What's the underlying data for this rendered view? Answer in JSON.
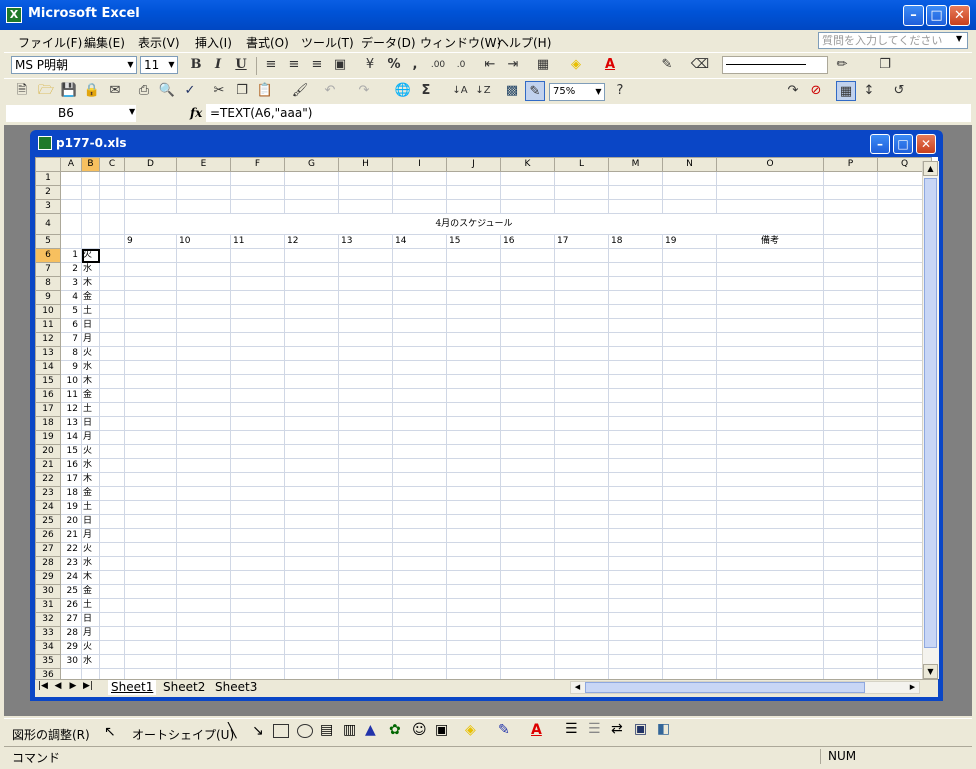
{
  "window": {
    "title": "Microsoft Excel",
    "app_icon": "X"
  },
  "menu": [
    "ファイル(F)",
    "編集(E)",
    "表示(V)",
    "挿入(I)",
    "書式(O)",
    "ツール(T)",
    "データ(D)",
    "ウィンドウ(W)",
    "ヘルプ(H)"
  ],
  "help_placeholder": "質問を入力してください",
  "format_toolbar": {
    "font": "MS P明朝",
    "size": "11",
    "bold": "B",
    "italic": "I",
    "underline": "U",
    "percent": "%",
    "comma": ","
  },
  "standard_toolbar": {
    "zoom": "75%",
    "sum": "Σ"
  },
  "formula_bar": {
    "cell": "B6",
    "fx": "fx",
    "formula": "=TEXT(A6,\"aaa\")"
  },
  "workbook": {
    "title": "p177-0.xls"
  },
  "columns": [
    "A",
    "B",
    "C",
    "D",
    "E",
    "F",
    "G",
    "H",
    "I",
    "J",
    "K",
    "L",
    "M",
    "N",
    "O",
    "P",
    "Q"
  ],
  "active_column": "B",
  "active_row": 6,
  "row_numbers": [
    1,
    2,
    3,
    4,
    5,
    6,
    7,
    8,
    9,
    10,
    11,
    12,
    13,
    14,
    15,
    16,
    17,
    18,
    19,
    20,
    21,
    22,
    23,
    24,
    25,
    26,
    27,
    28,
    29,
    30,
    31,
    32,
    33,
    34,
    35,
    36
  ],
  "sheet_title": "4月のスケジュール",
  "hours": [
    "9",
    "10",
    "11",
    "12",
    "13",
    "14",
    "15",
    "16",
    "17",
    "18",
    "19"
  ],
  "remarks_header": "備考",
  "days": [
    {
      "d": "1",
      "w": "火"
    },
    {
      "d": "2",
      "w": "水"
    },
    {
      "d": "3",
      "w": "木"
    },
    {
      "d": "4",
      "w": "金"
    },
    {
      "d": "5",
      "w": "土"
    },
    {
      "d": "6",
      "w": "日"
    },
    {
      "d": "7",
      "w": "月"
    },
    {
      "d": "8",
      "w": "火"
    },
    {
      "d": "9",
      "w": "水"
    },
    {
      "d": "10",
      "w": "木"
    },
    {
      "d": "11",
      "w": "金"
    },
    {
      "d": "12",
      "w": "土"
    },
    {
      "d": "13",
      "w": "日"
    },
    {
      "d": "14",
      "w": "月"
    },
    {
      "d": "15",
      "w": "火"
    },
    {
      "d": "16",
      "w": "水"
    },
    {
      "d": "17",
      "w": "木"
    },
    {
      "d": "18",
      "w": "金"
    },
    {
      "d": "19",
      "w": "土"
    },
    {
      "d": "20",
      "w": "日"
    },
    {
      "d": "21",
      "w": "月"
    },
    {
      "d": "22",
      "w": "火"
    },
    {
      "d": "23",
      "w": "水"
    },
    {
      "d": "24",
      "w": "木"
    },
    {
      "d": "25",
      "w": "金"
    },
    {
      "d": "26",
      "w": "土"
    },
    {
      "d": "27",
      "w": "日"
    },
    {
      "d": "28",
      "w": "月"
    },
    {
      "d": "29",
      "w": "火"
    },
    {
      "d": "30",
      "w": "水"
    }
  ],
  "sheet_tabs": [
    "Sheet1",
    "Sheet2",
    "Sheet3"
  ],
  "drawing_toolbar": {
    "draw": "図形の調整(R)",
    "autoshapes": "オートシェイプ(U)"
  },
  "status": {
    "mode": "コマンド",
    "num": "NUM"
  }
}
